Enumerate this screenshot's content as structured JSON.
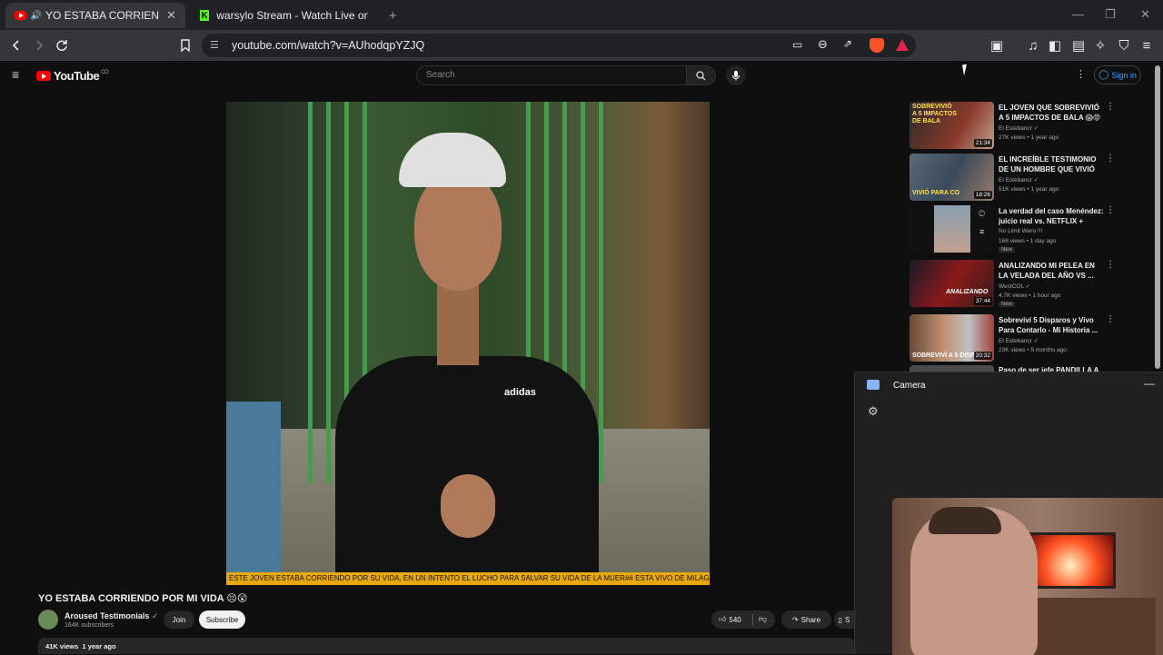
{
  "browser": {
    "tabs": [
      {
        "title": "YO ESTABA CORRIENDO POR",
        "close": "✕"
      },
      {
        "title": "warsylo Stream - Watch Live on Kick"
      }
    ],
    "new_tab": "+",
    "url": "youtube.com/watch?v=AUhodqpYZJQ",
    "window_controls": [
      "—",
      "❐",
      "✕"
    ]
  },
  "youtube": {
    "logo": "YouTube",
    "logo_country": "CO",
    "search_placeholder": "Search",
    "sign_in": "Sign in"
  },
  "video": {
    "caption": "ESTE JOVEN ESTABA CORRIENDO POR SU VIDA, EN UN INTENTO EL LUCHO PARA SALVAR SU VIDA DE LA MUER## ESTA VIVO DE MILAGRO",
    "shirt_logo": "adidas",
    "title": "YO ESTABA CORRIENDO POR MI VIDA 😣😲",
    "channel": "Aroused Testimonials",
    "subscribers": "164K subscribers",
    "join": "Join",
    "subscribe": "Subscribe",
    "likes": "540",
    "share": "Share",
    "save_partial": "S",
    "views": "41K views",
    "date": "1 year ago"
  },
  "related": [
    {
      "title": "EL JOVEN QUE SOBREVIVIÓ A 5 IMPACTOS DE BALA 😱😡",
      "channel": "El Estebancr ✓",
      "meta": "27K views • 1 year ago",
      "duration": "21:34",
      "thumb_text": "SOBREVIVIÓ A 5 IMPACTOS DE BALA",
      "new": ""
    },
    {
      "title": "EL INCREÍBLE TESTIMONIO DE UN HOMBRE QUE VIVIÓ PARA ...",
      "channel": "El Estebancr ✓",
      "meta": "51K views • 1 year ago",
      "duration": "18:26",
      "thumb_text": "VIVIÓ PARA CO",
      "new": ""
    },
    {
      "title": "La verdad del caso Menéndez: juicio real vs. NETFLIX + nuev...",
      "channel": "No Limit Wero !!!",
      "meta": "168 views • 1 day ago",
      "duration": "",
      "thumb_text": "",
      "new": "New"
    },
    {
      "title": "ANALIZANDO MI PELEA EN LA VELADA DEL AÑO VS ...",
      "channel": "WestCOL ✓",
      "meta": "4.7K views • 1 hour ago",
      "duration": "37:44",
      "thumb_text": "ANALIZANDO",
      "new": "New"
    },
    {
      "title": "Sobreviví 5 Disparos y Vivo Para Contarlo - Mi Historia ...",
      "channel": "El Estebancr ✓",
      "meta": "23K views • 5 months ago",
      "duration": "20:32",
      "thumb_text": "SOBREVIVÍ A 5 DISP",
      "new": ""
    },
    {
      "title": "Paso de ser jefe PANDILLA A",
      "channel": "",
      "meta": "",
      "duration": "",
      "thumb_text": "",
      "new": ""
    }
  ],
  "camera": {
    "title": "Camera",
    "minimize": "—"
  },
  "icons": {
    "back": "back-arrow-icon",
    "forward": "forward-arrow-icon",
    "reload": "reload-icon",
    "bookmark": "bookmark-icon",
    "site_info": "site-info-icon",
    "cast": "cast-icon",
    "zoom": "zoom-icon",
    "share": "share-icon",
    "menu": "hamburger-icon"
  },
  "colors": {
    "yt_red": "#ff0000",
    "kick_green": "#53fc18",
    "link_blue": "#3ea6ff",
    "caption_yellow": "#e8a910"
  }
}
